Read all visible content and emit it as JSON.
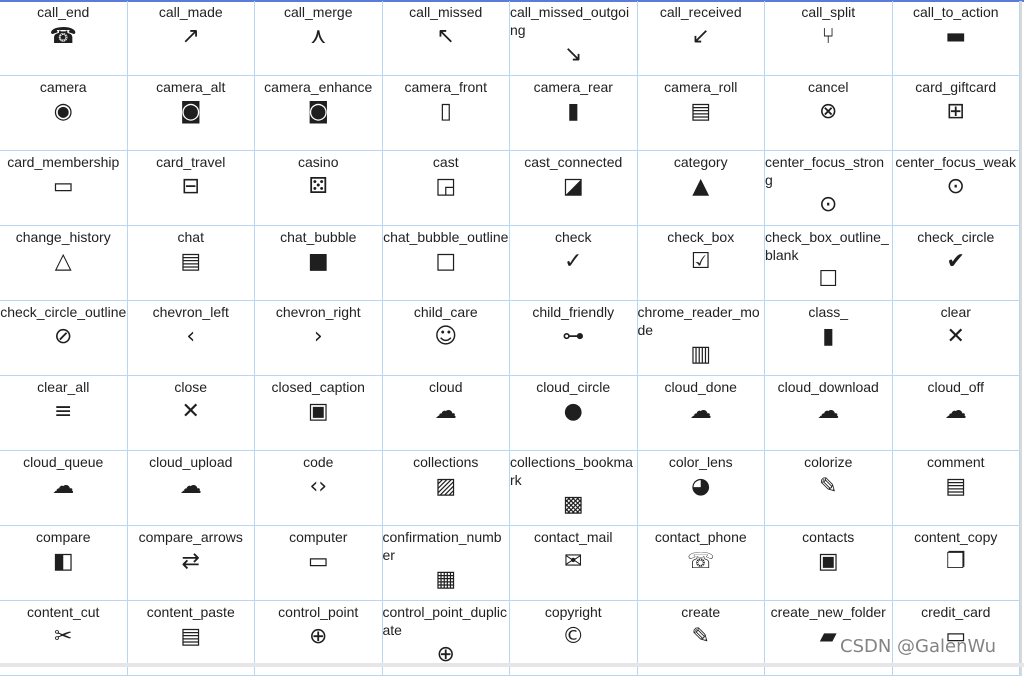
{
  "watermark": "CSDN @GalenWu",
  "colors": {
    "grid_line": "#b7d6f3",
    "icon": "#1f1f1f",
    "text": "#222222"
  },
  "items": [
    {
      "label": "call_end",
      "icon": "call-end"
    },
    {
      "label": "call_made",
      "icon": "call-made"
    },
    {
      "label": "call_merge",
      "icon": "call-merge"
    },
    {
      "label": "call_missed",
      "icon": "call-missed"
    },
    {
      "label": "call_missed_outgoing",
      "icon": "call-missed-outgoing"
    },
    {
      "label": "call_received",
      "icon": "call-received"
    },
    {
      "label": "call_split",
      "icon": "call-split"
    },
    {
      "label": "call_to_action",
      "icon": "call-to-action"
    },
    {
      "label": "camera",
      "icon": "camera"
    },
    {
      "label": "camera_alt",
      "icon": "camera-alt"
    },
    {
      "label": "camera_enhance",
      "icon": "camera-enhance"
    },
    {
      "label": "camera_front",
      "icon": "camera-front"
    },
    {
      "label": "camera_rear",
      "icon": "camera-rear"
    },
    {
      "label": "camera_roll",
      "icon": "camera-roll"
    },
    {
      "label": "cancel",
      "icon": "cancel"
    },
    {
      "label": "card_giftcard",
      "icon": "card-giftcard"
    },
    {
      "label": "card_membership",
      "icon": "card-membership"
    },
    {
      "label": "card_travel",
      "icon": "card-travel"
    },
    {
      "label": "casino",
      "icon": "casino"
    },
    {
      "label": "cast",
      "icon": "cast"
    },
    {
      "label": "cast_connected",
      "icon": "cast-connected"
    },
    {
      "label": "category",
      "icon": "category"
    },
    {
      "label": "center_focus_strong",
      "icon": "center-focus-strong"
    },
    {
      "label": "center_focus_weak",
      "icon": "center-focus-weak"
    },
    {
      "label": "change_history",
      "icon": "change-history"
    },
    {
      "label": "chat",
      "icon": "chat"
    },
    {
      "label": "chat_bubble",
      "icon": "chat-bubble"
    },
    {
      "label": "chat_bubble_outline",
      "icon": "chat-bubble-outline"
    },
    {
      "label": "check",
      "icon": "check"
    },
    {
      "label": "check_box",
      "icon": "check-box"
    },
    {
      "label": "check_box_outline_blank",
      "icon": "check-box-outline-blank"
    },
    {
      "label": "check_circle",
      "icon": "check-circle"
    },
    {
      "label": "check_circle_outline",
      "icon": "check-circle-outline"
    },
    {
      "label": "chevron_left",
      "icon": "chevron-left"
    },
    {
      "label": "chevron_right",
      "icon": "chevron-right"
    },
    {
      "label": "child_care",
      "icon": "child-care"
    },
    {
      "label": "child_friendly",
      "icon": "child-friendly"
    },
    {
      "label": "chrome_reader_mode",
      "icon": "chrome-reader-mode"
    },
    {
      "label": "class_",
      "icon": "class"
    },
    {
      "label": "clear",
      "icon": "clear"
    },
    {
      "label": "clear_all",
      "icon": "clear-all"
    },
    {
      "label": "close",
      "icon": "close"
    },
    {
      "label": "closed_caption",
      "icon": "closed-caption"
    },
    {
      "label": "cloud",
      "icon": "cloud"
    },
    {
      "label": "cloud_circle",
      "icon": "cloud-circle"
    },
    {
      "label": "cloud_done",
      "icon": "cloud-done"
    },
    {
      "label": "cloud_download",
      "icon": "cloud-download"
    },
    {
      "label": "cloud_off",
      "icon": "cloud-off"
    },
    {
      "label": "cloud_queue",
      "icon": "cloud-queue"
    },
    {
      "label": "cloud_upload",
      "icon": "cloud-upload"
    },
    {
      "label": "code",
      "icon": "code"
    },
    {
      "label": "collections",
      "icon": "collections"
    },
    {
      "label": "collections_bookmark",
      "icon": "collections-bookmark"
    },
    {
      "label": "color_lens",
      "icon": "color-lens"
    },
    {
      "label": "colorize",
      "icon": "colorize"
    },
    {
      "label": "comment",
      "icon": "comment"
    },
    {
      "label": "compare",
      "icon": "compare"
    },
    {
      "label": "compare_arrows",
      "icon": "compare-arrows"
    },
    {
      "label": "computer",
      "icon": "computer"
    },
    {
      "label": "confirmation_number",
      "icon": "confirmation-number"
    },
    {
      "label": "contact_mail",
      "icon": "contact-mail"
    },
    {
      "label": "contact_phone",
      "icon": "contact-phone"
    },
    {
      "label": "contacts",
      "icon": "contacts"
    },
    {
      "label": "content_copy",
      "icon": "content-copy"
    },
    {
      "label": "content_cut",
      "icon": "content-cut"
    },
    {
      "label": "content_paste",
      "icon": "content-paste"
    },
    {
      "label": "control_point",
      "icon": "control-point"
    },
    {
      "label": "control_point_duplicate",
      "icon": "control-point-duplicate"
    },
    {
      "label": "copyright",
      "icon": "copyright"
    },
    {
      "label": "create",
      "icon": "create"
    },
    {
      "label": "create_new_folder",
      "icon": "create-new-folder"
    },
    {
      "label": "credit_card",
      "icon": "credit-card"
    }
  ]
}
